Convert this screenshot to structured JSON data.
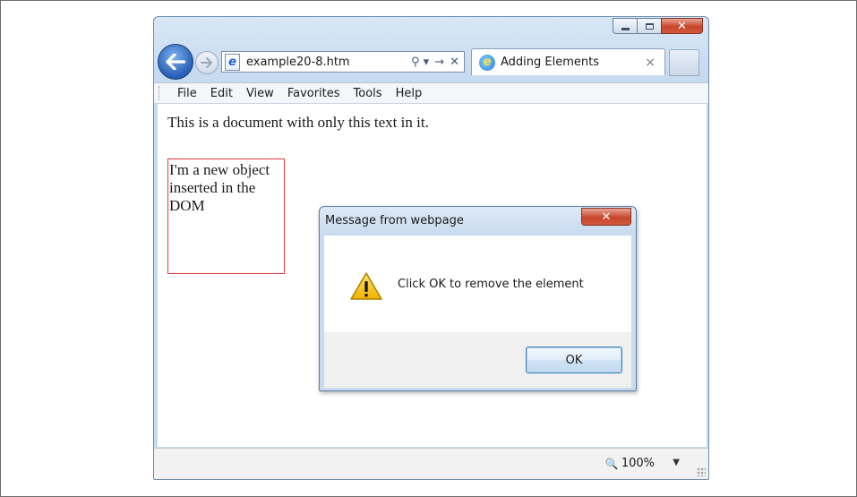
{
  "browser": {
    "address": "example20-8.htm",
    "tab_title": "Adding Elements",
    "tab_close": "×",
    "address_actions": [
      "⚲ ▾",
      "→",
      "✕"
    ]
  },
  "menu": {
    "items": [
      "File",
      "Edit",
      "View",
      "Favorites",
      "Tools",
      "Help"
    ]
  },
  "document": {
    "paragraph": "This is a document with only this text in it.",
    "inserted_box_text": "I'm a new object inserted in the DOM"
  },
  "status": {
    "zoom": "100%"
  },
  "dialog": {
    "title": "Message from webpage",
    "message": "Click OK to remove the element",
    "ok_label": "OK"
  }
}
